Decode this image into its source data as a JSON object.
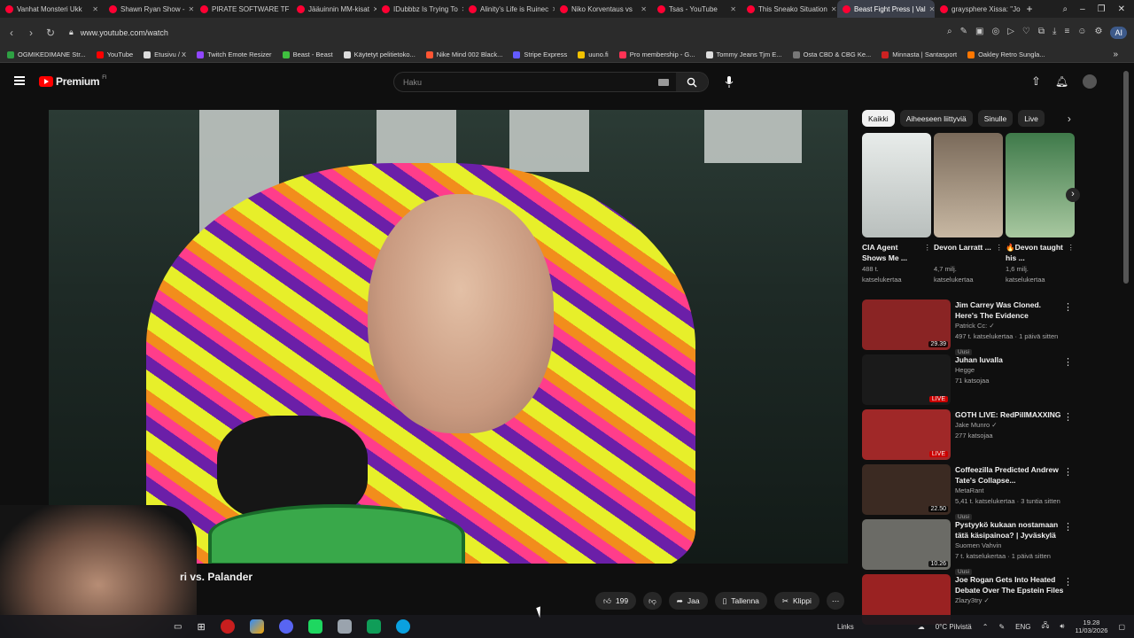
{
  "browser": {
    "tabs": [
      {
        "label": "Vanhat Monsteri Ukk",
        "active": false
      },
      {
        "label": "Shawn Ryan Show -",
        "active": false
      },
      {
        "label": "PIRATE SOFTWARE TF",
        "active": false
      },
      {
        "label": "Jääuinnin MM-kisat",
        "active": false
      },
      {
        "label": "IDubbbz Is Trying To",
        "active": false
      },
      {
        "label": "Alinity's Life is Ruinec",
        "active": false
      },
      {
        "label": "Niko Korventaus vs",
        "active": false
      },
      {
        "label": "Tsas - YouTube",
        "active": false
      },
      {
        "label": "This Sneako Situation",
        "active": false
      },
      {
        "label": "Beast Fight Press | Val",
        "active": true
      },
      {
        "label": "graysphere Xissa: \"Jo",
        "active": false
      }
    ],
    "url": "www.youtube.com/watch",
    "bookmarks": [
      {
        "label": "OGMIKEDIMANE Str...",
        "color": "#2ea043"
      },
      {
        "label": "YouTube",
        "color": "#ff0000"
      },
      {
        "label": "Etusivu / X",
        "color": "#dddddd"
      },
      {
        "label": "Twitch Emote Resizer",
        "color": "#9146ff"
      },
      {
        "label": "Beast - Beast",
        "color": "#3fbf3f"
      },
      {
        "label": "Käytetyt pelitietoko...",
        "color": "#dddddd"
      },
      {
        "label": "Nike Mind 002 Black...",
        "color": "#ff5533"
      },
      {
        "label": "Stripe Express",
        "color": "#635bff"
      },
      {
        "label": "uuno.fi",
        "color": "#f2c200"
      },
      {
        "label": "Pro membership - G...",
        "color": "#ff3355"
      },
      {
        "label": "Tommy Jeans Tjm E...",
        "color": "#dddddd"
      },
      {
        "label": "Osta CBD & CBG Ke...",
        "color": "#777777"
      },
      {
        "label": "Minnasta | Santasport",
        "color": "#cc2222"
      },
      {
        "label": "Oakley Retro Sungla...",
        "color": "#ff7700"
      }
    ],
    "ai_label": "AI"
  },
  "youtube": {
    "logo_text": "Premium",
    "logo_sup": "FI",
    "search_placeholder": "Haku",
    "video_title": "ri vs. Palander",
    "actions": {
      "likes": "199",
      "share": "Jaa",
      "save": "Tallenna",
      "clip": "Klippi"
    },
    "chips": [
      "Kaikki",
      "Aiheeseen liittyviä",
      "Sinulle",
      "Live"
    ],
    "shorts": [
      {
        "title": "CIA Agent Shows Me ...",
        "views": "488 t.",
        "views2": "katselukertaa"
      },
      {
        "title": "Devon Larratt ...",
        "views": "4,7 milj.",
        "views2": "katselukertaa"
      },
      {
        "title": "🔥Devon taught his ...",
        "views": "1,6 milj.",
        "views2": "katselukertaa"
      }
    ],
    "recommendations": [
      {
        "title": "Jim Carrey Was Cloned. Here's The Evidence",
        "channel": "Patrick Cc: ✓",
        "meta": "497 t. katselukertaa · 1 päivä sitten",
        "badge": "Uusi",
        "duration": "29.39",
        "live": "",
        "thumb": "#8a2424"
      },
      {
        "title": "Juhan luvalla",
        "channel": "Hegge",
        "meta": "71 katsojaa",
        "badge": "",
        "duration": "",
        "live": "LIVE",
        "thumb": "#1a1a1a"
      },
      {
        "title": "GOTH LIVE: RedPillMAXXING",
        "channel": "Jake Munro ✓",
        "meta": "277 katsojaa",
        "badge": "",
        "duration": "",
        "live": "LIVE",
        "thumb": "#a02828"
      },
      {
        "title": "Coffeezilla Predicted Andrew Tate's Collapse...",
        "channel": "MetaRant",
        "meta": "5,41 t. katselukertaa · 3 tuntia sitten",
        "badge": "Uusi",
        "duration": "22.50",
        "live": "",
        "thumb": "#3b2a22"
      },
      {
        "title": "Pystyykö kukaan nostamaan tätä käsipainoa? | Jyväskylä",
        "channel": "Suomen Vahvin",
        "meta": "7 t. katselukertaa · 1 päivä sitten",
        "badge": "Uusi",
        "duration": "10.26",
        "live": "",
        "thumb": "#6b6b66"
      },
      {
        "title": "Joe Rogan Gets Into Heated Debate Over The Epstein Files",
        "channel": "Zlazy3try ✓",
        "meta": "",
        "badge": "",
        "duration": "",
        "live": "",
        "thumb": "#9a2222"
      }
    ]
  },
  "taskbar": {
    "links_label": "Links",
    "weather": "0°C  Pilvistä",
    "lang": "ENG",
    "time": "19.28",
    "date": "11/03/2026"
  }
}
